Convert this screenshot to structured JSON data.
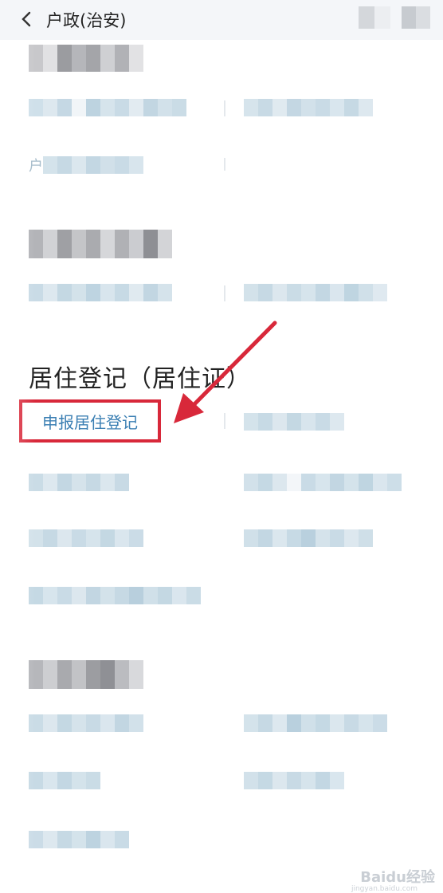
{
  "header": {
    "title": "户政(治安)",
    "back_icon": "chevron-left-icon"
  },
  "sections": {
    "residence": {
      "title": "居住登记（居住证）",
      "apply_link": "申报居住登记"
    }
  },
  "partial_text": {
    "item_prefix": "户"
  },
  "annotation": {
    "arrow_color": "#d8283a",
    "box_color": "#d8283a"
  },
  "watermark": {
    "brand": "Baidu经验",
    "sub": "jingyan.baidu.com"
  },
  "colors": {
    "link": "#3b7fb3",
    "mosaic_light": "#dbe6ee",
    "mosaic_dark": "#7e8a96"
  }
}
